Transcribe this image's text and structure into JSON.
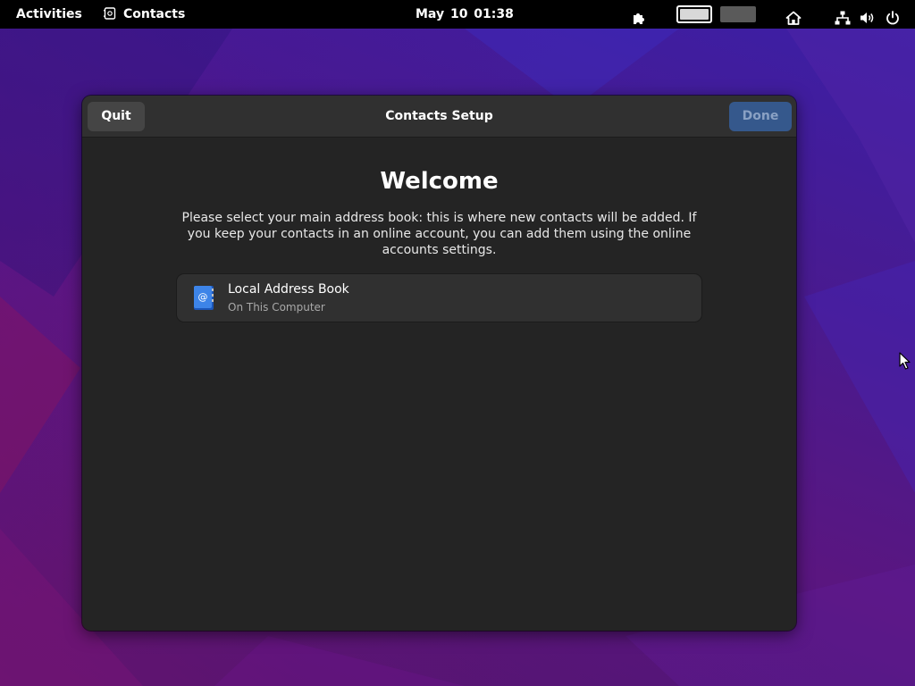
{
  "topbar": {
    "activities": "Activities",
    "app_name": "Contacts",
    "clock": "May 10  01:38",
    "icons": [
      "contacts-app-icon",
      "extensions-icon",
      "home-icon",
      "network-icon",
      "volume-icon",
      "power-icon"
    ]
  },
  "dialog": {
    "title": "Contacts Setup",
    "quit_label": "Quit",
    "done_label": "Done",
    "heading": "Welcome",
    "description": "Please select your main address book: this is where new contacts will be added. If you keep your contacts in an online account, you can add them using the online accounts settings.",
    "address_books": [
      {
        "name": "Local Address Book",
        "location": "On This Computer",
        "icon": "address-book-icon"
      }
    ]
  },
  "colors": {
    "accent_disabled": "#35588c",
    "dialog_bg": "#242424",
    "headerbar_bg": "#303030"
  }
}
